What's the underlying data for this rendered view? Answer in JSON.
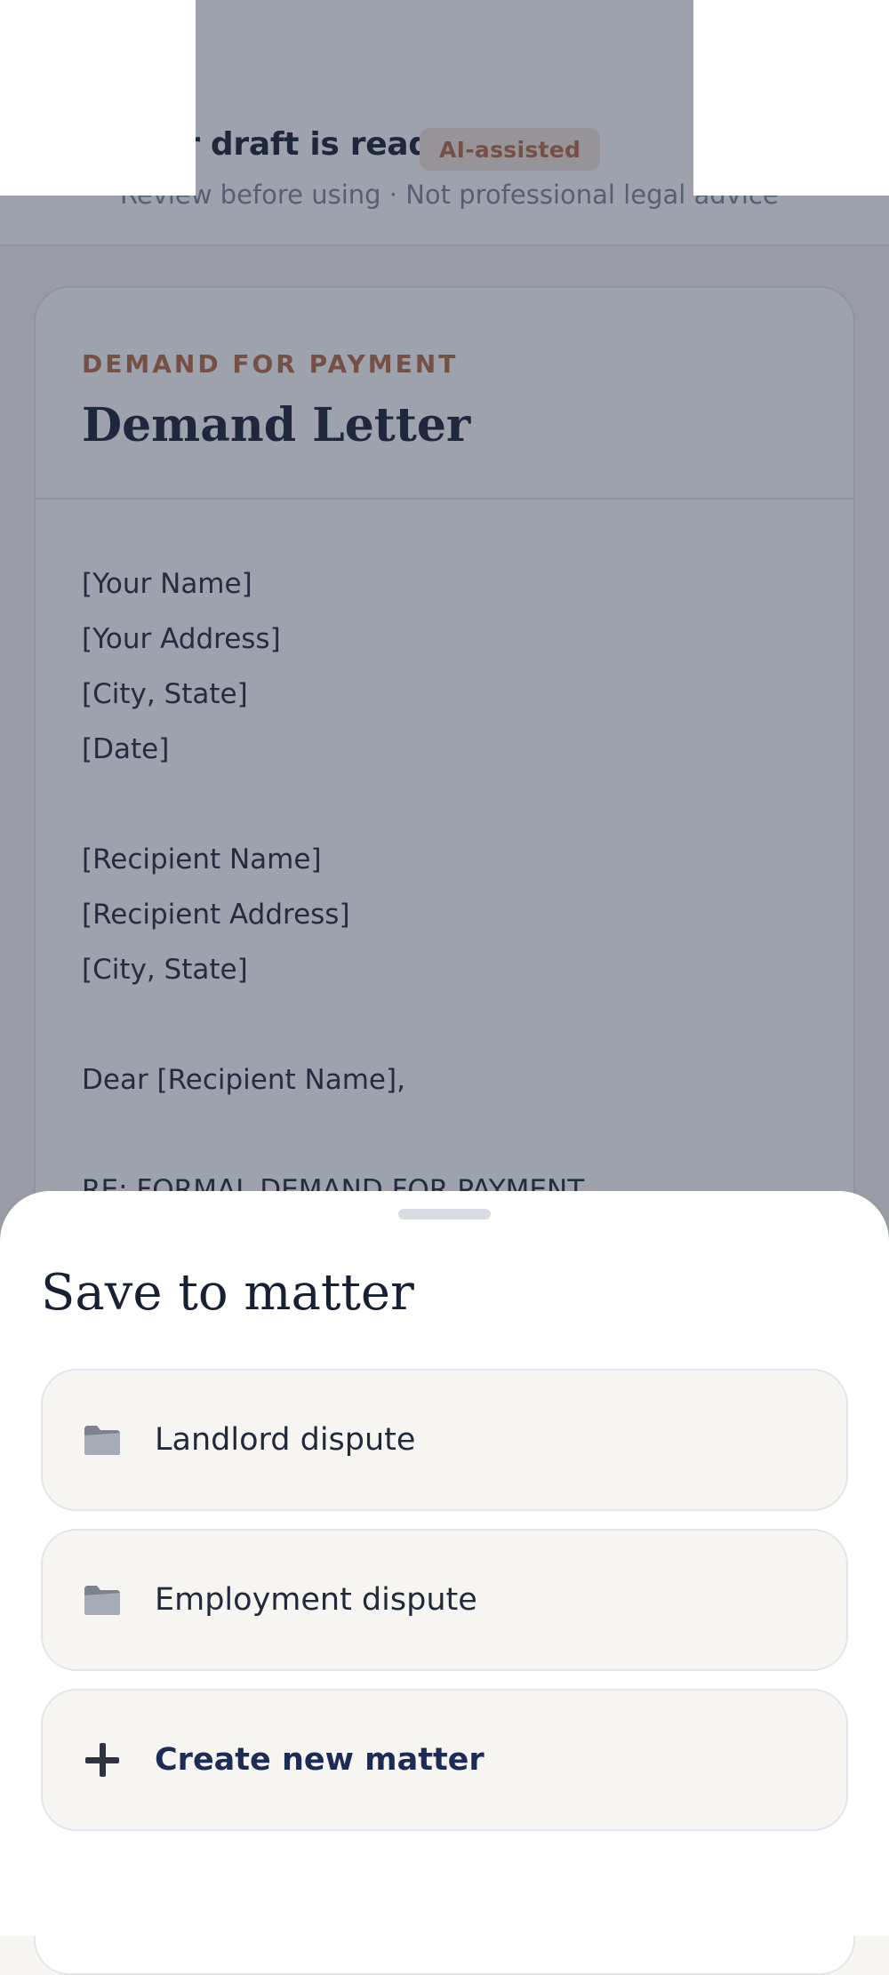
{
  "header": {
    "title": "Your draft is ready",
    "badge": "AI-assisted",
    "subtitle": "Review before using · Not professional legal advice"
  },
  "document": {
    "eyebrow": "DEMAND FOR PAYMENT",
    "title": "Demand Letter",
    "lines": [
      "[Your Name]",
      "[Your Address]",
      "[City, State]",
      "[Date]",
      "",
      "[Recipient Name]",
      "[Recipient Address]",
      "[City, State]",
      "",
      "Dear [Recipient Name],",
      "",
      "RE: FORMAL DEMAND FOR PAYMENT"
    ]
  },
  "sheet": {
    "title": "Save to matter",
    "matters": [
      {
        "label": "Landlord dispute",
        "icon": "folder-icon"
      },
      {
        "label": "Employment dispute",
        "icon": "folder-icon"
      }
    ],
    "create_label": "Create new matter"
  },
  "colors": {
    "accent": "#b26b45",
    "ink": "#182033",
    "scrim": "#283046"
  }
}
